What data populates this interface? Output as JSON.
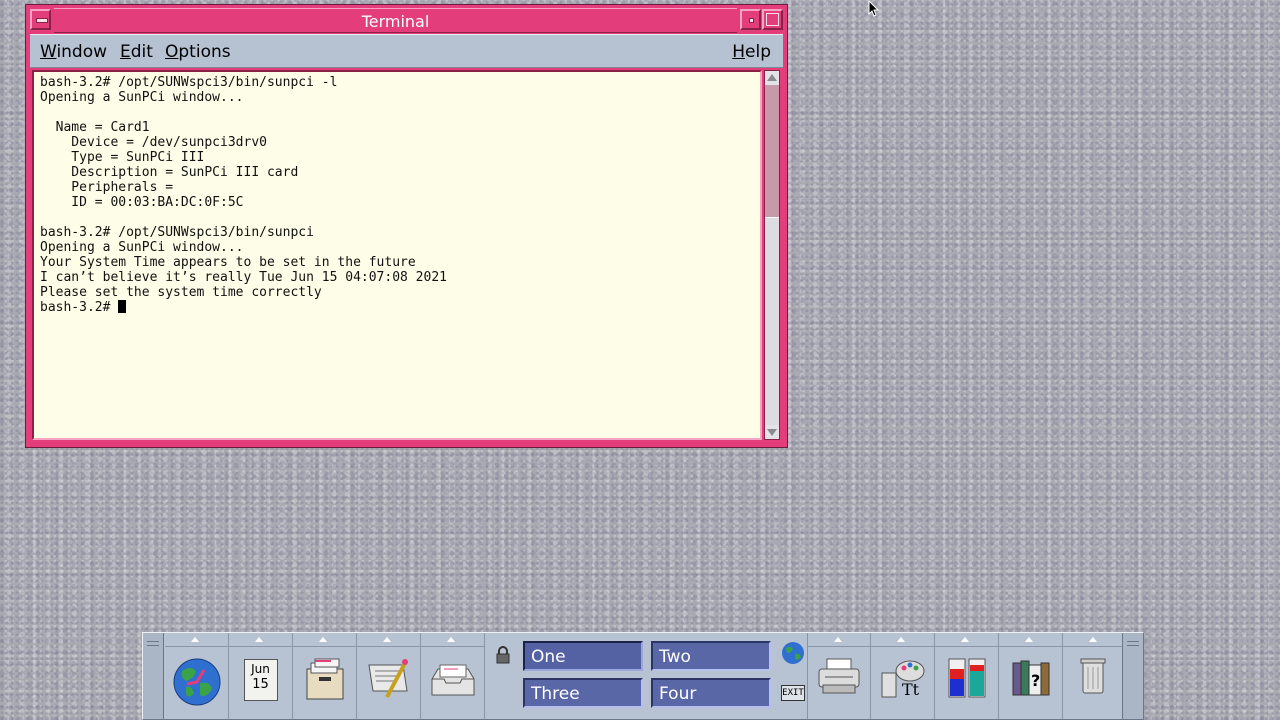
{
  "window": {
    "title": "Terminal",
    "menus": [
      {
        "label": "Window",
        "mnemonic": "W",
        "rest": "indow"
      },
      {
        "label": "Edit",
        "mnemonic": "E",
        "rest": "dit"
      },
      {
        "label": "Options",
        "mnemonic": "O",
        "rest": "ptions"
      }
    ],
    "help_menu": {
      "label": "Help",
      "mnemonic": "H",
      "rest": "elp"
    },
    "terminal_lines": [
      "bash-3.2# /opt/SUNWspci3/bin/sunpci -l",
      "Opening a SunPCi window...",
      "",
      "  Name = Card1",
      "    Device = /dev/sunpci3drv0",
      "    Type = SunPCi III",
      "    Description = SunPCi III card",
      "    Peripherals =",
      "    ID = 00:03:BA:DC:0F:5C",
      "",
      "bash-3.2# /opt/SUNWspci3/bin/sunpci",
      "Opening a SunPCi window...",
      "Your System Time appears to be set in the future",
      "I can’t believe it’s really Tue Jun 15 04:07:08 2021",
      "Please set the system time correctly"
    ],
    "prompt": "bash-3.2# "
  },
  "panel": {
    "calendar": {
      "month": "Jun",
      "day": "15"
    },
    "workspaces": [
      "One",
      "Two",
      "Three",
      "Four"
    ],
    "exit_label": "EXIT",
    "left_icons": [
      "globe-clock-icon",
      "calendar-icon",
      "file-manager-icon",
      "text-editor-icon",
      "mailer-icon"
    ],
    "right_icons": [
      "printer-icon",
      "style-manager-icon",
      "performance-meter-icon",
      "help-books-icon",
      "trash-icon"
    ]
  },
  "colors": {
    "window_frame": "#e33d7b",
    "menubar": "#b6c2d2",
    "terminal_bg": "#fefde8",
    "panel_bg": "#b7c3d3",
    "workspace_button": "#5a67a7"
  }
}
